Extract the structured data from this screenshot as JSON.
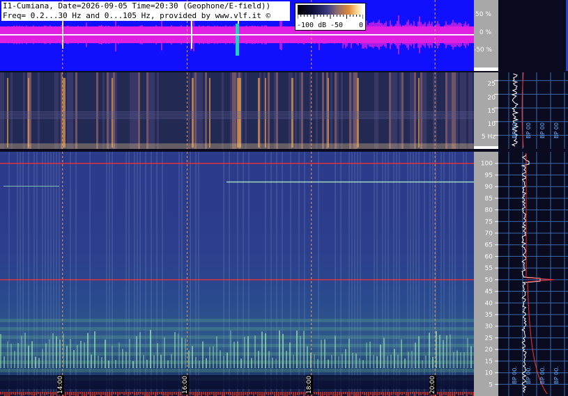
{
  "header": {
    "line1": "I1-Cumiana, Date=2026-09-05 Time=20:30 (Geophone/E-field))",
    "line2": "Freq= 0.2...30 Hz and 0...105 Hz, provided by www.vlf.it ©"
  },
  "legend": {
    "min_label": "-100 dB",
    "mid_label": "-50",
    "max_label": "0",
    "colors": [
      "#000000",
      "#3a3a80",
      "#e08a3a",
      "#ffffff"
    ]
  },
  "waveform_scale": {
    "labels": [
      "50 %",
      "0 %",
      "-50 %"
    ]
  },
  "spec1_scale": {
    "labels": [
      "25",
      "20",
      "15",
      "10",
      "5 Hz"
    ],
    "values": [
      25,
      20,
      15,
      10,
      5
    ],
    "max": 28
  },
  "spec2_scale": {
    "labels": [
      "100",
      "95",
      "90",
      "85",
      "80",
      "75",
      "70",
      "65",
      "60",
      "55",
      "50",
      "45",
      "40",
      "35",
      "30",
      "25",
      "20",
      "15",
      "10",
      "5"
    ],
    "values": [
      100,
      95,
      90,
      85,
      80,
      75,
      70,
      65,
      60,
      55,
      50,
      45,
      40,
      35,
      30,
      25,
      20,
      15,
      10,
      5
    ],
    "max": 105
  },
  "time_markers": [
    {
      "label": "14:00",
      "pos": 0.132
    },
    {
      "label": "16:00",
      "pos": 0.395
    },
    {
      "label": "18:00",
      "pos": 0.657
    },
    {
      "label": "20:00",
      "pos": 0.918
    }
  ],
  "side_bp_labels_top": [
    "BP 00",
    "BP 00",
    "BP 00",
    "BP 00"
  ],
  "side_bp_labels_bottom": [
    "BP 00.",
    "BP 00.",
    "BP 00.",
    "BP 00."
  ],
  "colors": {
    "waveform_bg": "#1010ff",
    "waveform_signal": "#e020e0",
    "hum_line": "#ff3030"
  }
}
